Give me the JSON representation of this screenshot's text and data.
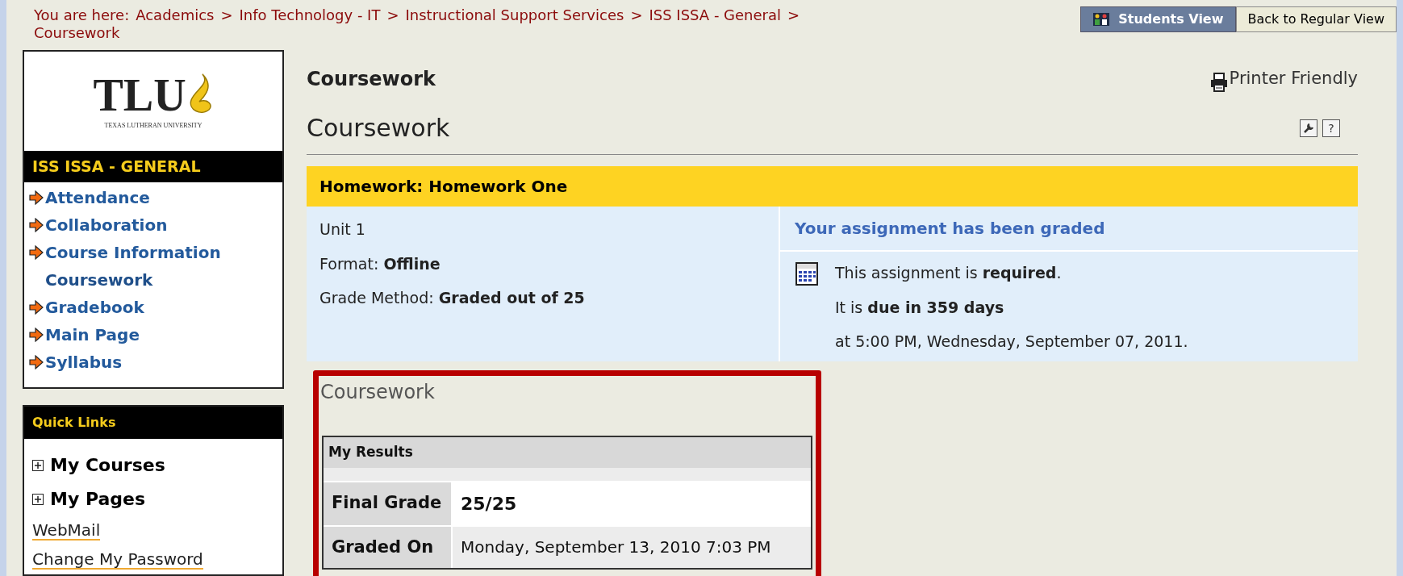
{
  "breadcrumb": {
    "label": "You are here:",
    "items": [
      {
        "label": "Academics",
        "separator": ">"
      },
      {
        "label": "Info Technology - IT",
        "separator": ">"
      },
      {
        "label": "Instructional Support Services",
        "separator": ">"
      },
      {
        "label": "ISS ISSA - General",
        "separator": ">"
      },
      {
        "label": "Coursework"
      }
    ]
  },
  "view_switch": {
    "current": "Students View",
    "back_button": "Back to Regular View"
  },
  "sidebar": {
    "logo": {
      "text": "TLU",
      "subtitle": "TEXAS LUTHERAN UNIVERSITY"
    },
    "course_title": "ISS ISSA - GENERAL",
    "items": [
      {
        "label": "Attendance",
        "selected": false
      },
      {
        "label": "Collaboration",
        "selected": false
      },
      {
        "label": "Course Information",
        "selected": false
      },
      {
        "label": "Coursework",
        "selected": true
      },
      {
        "label": "Gradebook",
        "selected": false
      },
      {
        "label": "Main Page",
        "selected": false
      },
      {
        "label": "Syllabus",
        "selected": false
      }
    ]
  },
  "quick_links": {
    "title": "Quick Links",
    "items": [
      {
        "kind": "expandable",
        "label": "My Courses",
        "expanded": false
      },
      {
        "kind": "expandable",
        "label": "My Pages",
        "expanded": false
      },
      {
        "kind": "link",
        "label": "WebMail"
      },
      {
        "kind": "link",
        "label": "Change My Password"
      }
    ]
  },
  "page": {
    "heading": "Coursework",
    "printer_link": "Printer Friendly",
    "title": "Coursework",
    "help_button": "?"
  },
  "assignment": {
    "header": "Homework: Homework One",
    "details": [
      "Unit 1",
      "Format: **Offline**",
      "Grade Method: **Graded out of 25**"
    ],
    "status": "Your assignment has been graded",
    "due_lines": [
      "This assignment is **required**.",
      "It is **due in 359 days**",
      "at 5:00 PM, Wednesday, September 07, 2011."
    ]
  },
  "results_panel": {
    "title": "Coursework",
    "table_title": "My Results",
    "rows": [
      {
        "label": "Final Grade",
        "value": "25/25",
        "emphasis": true
      },
      {
        "label": "Graded On",
        "value": "Monday, September 13, 2010 7:03 PM",
        "emphasis": false
      }
    ]
  }
}
